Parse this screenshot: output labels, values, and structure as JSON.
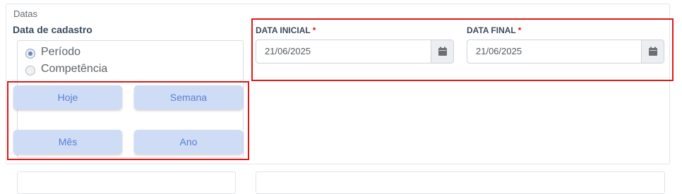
{
  "section": {
    "title": "Datas"
  },
  "date_type": {
    "label": "Data de cadastro",
    "options": [
      {
        "label": "Período",
        "checked": true
      },
      {
        "label": "Competência",
        "checked": false
      }
    ]
  },
  "quick_ranges": {
    "today": "Hoje",
    "week": "Semana",
    "month": "Mês",
    "year": "Ano"
  },
  "start_date": {
    "label": "DATA INICIAL",
    "required_mark": "*",
    "value": "21/06/2025",
    "icon": "calendar-icon"
  },
  "end_date": {
    "label": "DATA FINAL",
    "required_mark": "*",
    "value": "21/06/2025",
    "icon": "calendar-icon"
  },
  "colors": {
    "highlight": "#e01818",
    "button_bg": "#cfdcf6",
    "button_text": "#5b7fd0",
    "label": "#3a4c5e"
  }
}
